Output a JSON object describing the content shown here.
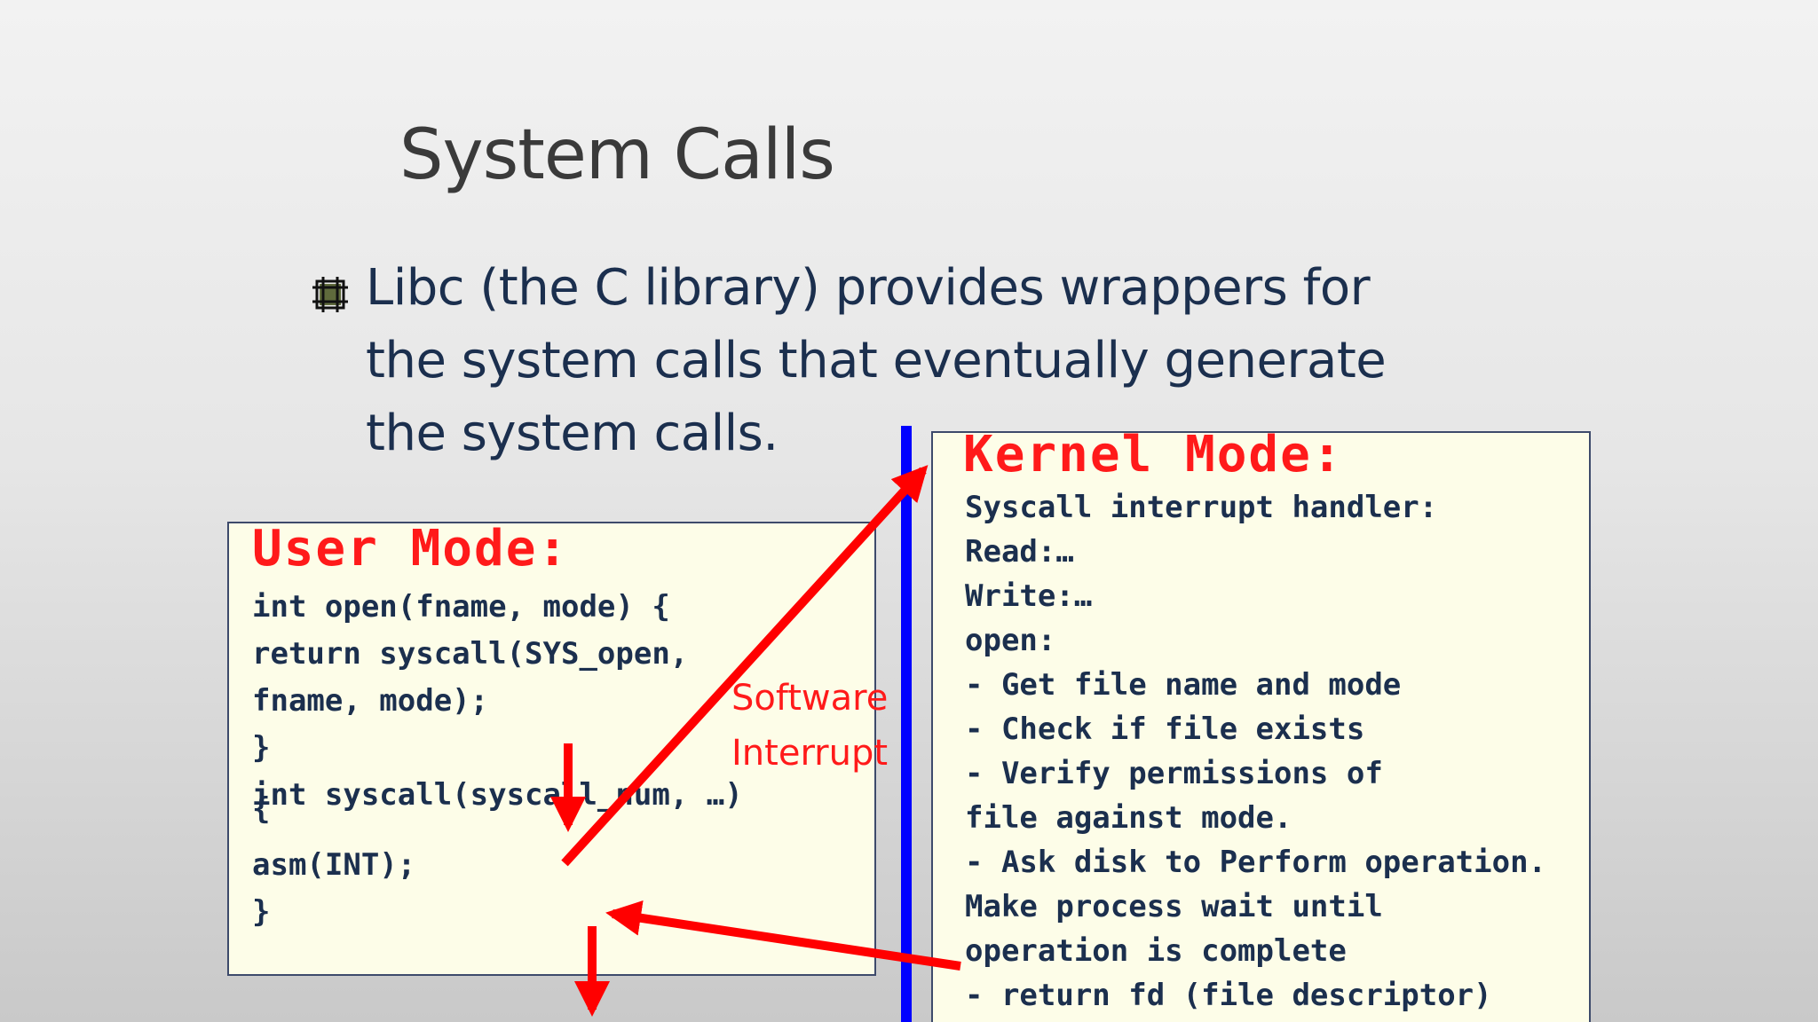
{
  "slide": {
    "title": "System Calls",
    "bullet": {
      "icon": "square-bullet-icon",
      "lines": [
        "Libc (the C library) provides wrappers for",
        "the system calls that eventually generate",
        "the system calls."
      ]
    }
  },
  "user_mode": {
    "title": "User Mode:",
    "code": [
      "int open(fname, mode) {",
      "  return syscall(SYS_open,",
      "  fname, mode);",
      "}",
      "int syscall(syscall_num, …)",
      "{",
      "  asm(INT);",
      "}"
    ]
  },
  "kernel_mode": {
    "title": "Kernel Mode:",
    "code": [
      "Syscall interrupt handler:",
      "Read:…",
      "Write:…",
      "open:",
      "  - Get file name and mode",
      "  - Check if file exists",
      "  - Verify permissions of",
      "    file against mode.",
      "  - Ask disk to Perform operation.",
      "    Make process wait until",
      "    operation is complete",
      "  - return fd (file descriptor)"
    ]
  },
  "annotation": {
    "line1": "Software",
    "line2": "Interrupt"
  },
  "colors": {
    "arrow": "#ff0000",
    "divider": "#0000ff",
    "box_fill": "#fdfde8",
    "title_text": "#3a3a3a",
    "body_text": "#1b2f4e"
  }
}
